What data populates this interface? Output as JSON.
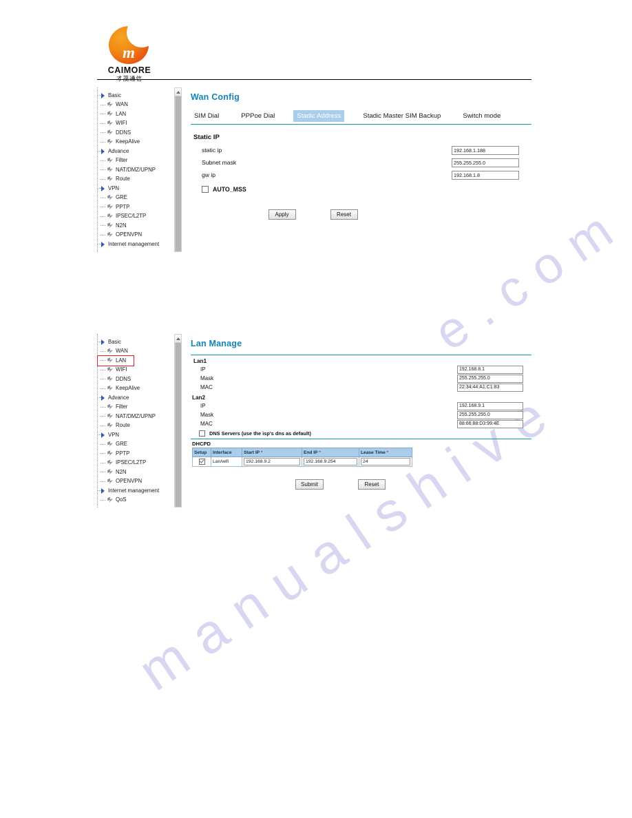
{
  "brand": {
    "name": "CAIMORE",
    "subtitle": "才茂通信",
    "logo_icon": "crescent-moon-logo",
    "logo_colors": {
      "start": "#f7a321",
      "end": "#e2490f"
    }
  },
  "colors": {
    "heading": "#1484b8",
    "tab_active_bg": "#a9cdea",
    "rule": "#0f9aa8",
    "annotation": "#e02020",
    "table_header_bg": "#a9cdea",
    "watermark": "#d7d7f2"
  },
  "watermark": {
    "line1": "e . c o m",
    "line2": "m a n u a l s h i v e"
  },
  "sidebar_tree": {
    "nodes": [
      {
        "label": "Basic",
        "type": "parent",
        "icon": "triangle-right-icon"
      },
      {
        "label": "WAN",
        "type": "child",
        "icon": "page-icon"
      },
      {
        "label": "LAN",
        "type": "child",
        "icon": "page-icon"
      },
      {
        "label": "WIFI",
        "type": "child",
        "icon": "page-icon"
      },
      {
        "label": "DDNS",
        "type": "child",
        "icon": "page-icon"
      },
      {
        "label": "KeepAlive",
        "type": "child",
        "icon": "page-icon"
      },
      {
        "label": "Advance",
        "type": "parent",
        "icon": "triangle-right-icon"
      },
      {
        "label": "Filter",
        "type": "child",
        "icon": "page-icon"
      },
      {
        "label": "NAT/DMZ/UPNP",
        "type": "child",
        "icon": "page-icon"
      },
      {
        "label": "Route",
        "type": "child",
        "icon": "page-icon"
      },
      {
        "label": "VPN",
        "type": "parent",
        "icon": "triangle-right-icon"
      },
      {
        "label": "GRE",
        "type": "child",
        "icon": "page-icon"
      },
      {
        "label": "PPTP",
        "type": "child",
        "icon": "page-icon"
      },
      {
        "label": "IPSEC/L2TP",
        "type": "child",
        "icon": "page-icon"
      },
      {
        "label": "N2N",
        "type": "child",
        "icon": "page-icon"
      },
      {
        "label": "OPENVPN",
        "type": "child",
        "icon": "page-icon"
      },
      {
        "label": "Internet management",
        "type": "parent",
        "icon": "triangle-right-icon"
      },
      {
        "label": "QoS",
        "type": "child",
        "icon": "page-icon"
      }
    ]
  },
  "panel_wan": {
    "title": "Wan Config",
    "tabs": [
      {
        "label": "SIM Dial",
        "active": false
      },
      {
        "label": "PPPoe Dial",
        "active": false
      },
      {
        "label": "Stadic Address",
        "active": true
      },
      {
        "label": "Stadic Master SIM Backup",
        "active": false
      },
      {
        "label": "Switch mode",
        "active": false
      }
    ],
    "section_title": "Static IP",
    "fields": [
      {
        "label": "static ip",
        "value": "192.168.1.188"
      },
      {
        "label": "Subnet mask",
        "value": "255.255.255.0"
      },
      {
        "label": "gw ip",
        "value": "192.168.1.8"
      }
    ],
    "checkbox": {
      "label": "AUTO_MSS",
      "checked": false
    },
    "buttons": {
      "apply": "Apply",
      "reset": "Reset"
    }
  },
  "panel_lan": {
    "title": "Lan Manage",
    "lan1": {
      "group_label": "Lan1",
      "rows": [
        {
          "label": "IP",
          "value": "192.168.8.1"
        },
        {
          "label": "Mask",
          "value": "255.255.255.0"
        },
        {
          "label": "MAC",
          "value": "22:34:44:A1:C1:83"
        }
      ]
    },
    "lan2": {
      "group_label": "Lan2",
      "rows": [
        {
          "label": "IP",
          "value": "192.168.9.1"
        },
        {
          "label": "Mask",
          "value": "255.255.255.0"
        },
        {
          "label": "MAC",
          "value": "88:66:88:D3:99:4E"
        }
      ]
    },
    "dns_checkbox": {
      "label": "DNS Servers (use the isp's dns as default)",
      "checked": false
    },
    "dhcpd": {
      "title": "DHCPD",
      "columns": [
        "Setup",
        "Interface",
        "Start IP",
        "End IP",
        "Lease Time"
      ],
      "required_marker": "*",
      "rows": [
        {
          "setup_checked": true,
          "interface": "Lan/wifi",
          "start_ip": "192.168.9.2",
          "end_ip": "192.168.9.254",
          "lease_time": "24"
        }
      ]
    },
    "buttons": {
      "submit": "Submit",
      "reset": "Reset"
    },
    "annotation": {
      "target": "LAN",
      "shape": "red-rectangle"
    }
  }
}
